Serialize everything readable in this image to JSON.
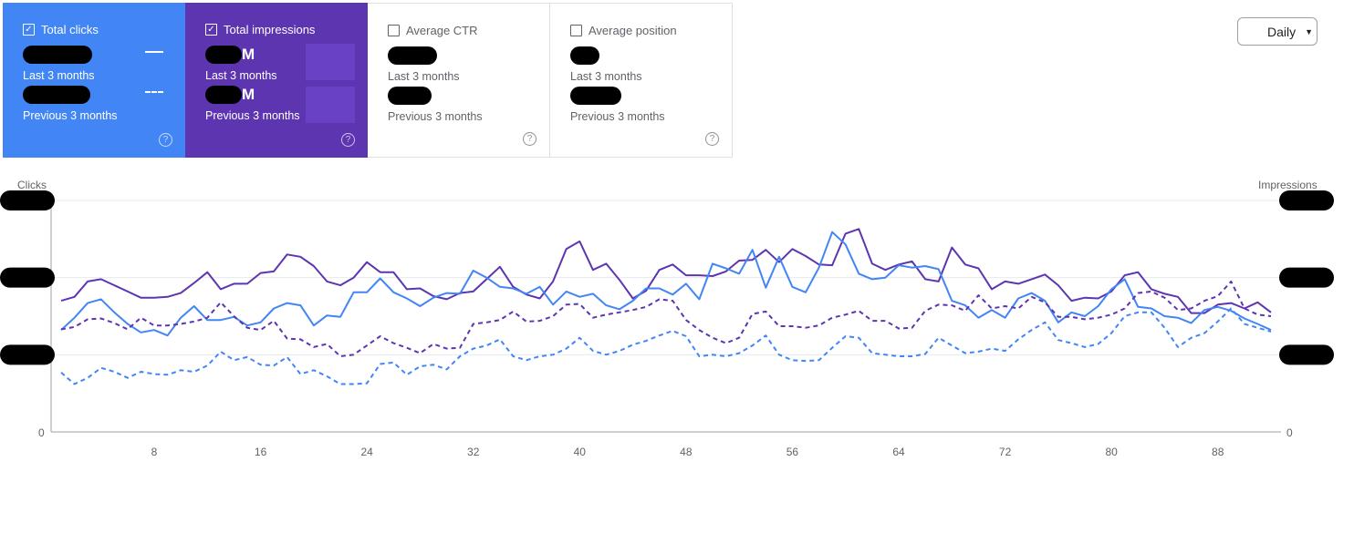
{
  "cards": [
    {
      "label": "Total clicks",
      "checked": true,
      "suffix": "",
      "period1": "Last 3 months",
      "period2": "Previous 3 months"
    },
    {
      "label": "Total impressions",
      "checked": true,
      "suffix": "M",
      "period1": "Last 3 months",
      "period2": "Previous 3 months"
    },
    {
      "label": "Average CTR",
      "checked": false,
      "suffix": "",
      "period1": "Last 3 months",
      "period2": "Previous 3 months"
    },
    {
      "label": "Average position",
      "checked": false,
      "suffix": "",
      "period1": "Last 3 months",
      "period2": "Previous 3 months"
    }
  ],
  "granularity": {
    "label": "Daily"
  },
  "colors": {
    "clicks": "#4285f4",
    "impressions": "#5e35b1",
    "grid": "#e8eaed"
  },
  "chart_data": {
    "type": "line",
    "ylabel_left": "Clicks",
    "ylabel_right": "Impressions",
    "xticks": [
      8,
      16,
      24,
      32,
      40,
      48,
      56,
      64,
      72,
      80,
      88
    ],
    "xlim": [
      1,
      92
    ],
    "ylim": [
      0,
      3
    ],
    "y_tick_labels_left": [
      "0"
    ],
    "y_tick_labels_right": [
      "0"
    ],
    "series": [
      {
        "name": "Total impressions",
        "period": "Last 3 months",
        "style": "solid",
        "color": "#5e35b1",
        "values": [
          1.7,
          1.75,
          1.95,
          1.98,
          1.9,
          1.82,
          1.74,
          1.74,
          1.75,
          1.8,
          1.93,
          2.07,
          1.85,
          1.92,
          1.92,
          2.06,
          2.08,
          2.3,
          2.27,
          2.15,
          1.95,
          1.9,
          2.0,
          2.2,
          2.07,
          2.07,
          1.85,
          1.86,
          1.76,
          1.72,
          1.8,
          1.82,
          1.98,
          2.14,
          1.88,
          1.78,
          1.73,
          1.95,
          2.37,
          2.47,
          2.1,
          2.18,
          1.97,
          1.73,
          1.83,
          2.1,
          2.17,
          2.03,
          2.03,
          2.02,
          2.08,
          2.22,
          2.23,
          2.36,
          2.2,
          2.37,
          2.28,
          2.17,
          2.16,
          2.57,
          2.63,
          2.18,
          2.1,
          2.17,
          2.21,
          1.98,
          1.95,
          2.39,
          2.17,
          2.12,
          1.85,
          1.95,
          1.92,
          1.98,
          2.04,
          1.9,
          1.7,
          1.74,
          1.73,
          1.82,
          2.03,
          2.07,
          1.85,
          1.79,
          1.75,
          1.54,
          1.54,
          1.65,
          1.67,
          1.6,
          1.68,
          1.55
        ]
      },
      {
        "name": "Total clicks",
        "period": "Last 3 months",
        "style": "solid",
        "color": "#4285f4",
        "values": [
          1.32,
          1.48,
          1.67,
          1.72,
          1.55,
          1.4,
          1.29,
          1.32,
          1.25,
          1.48,
          1.63,
          1.45,
          1.45,
          1.49,
          1.38,
          1.42,
          1.6,
          1.67,
          1.64,
          1.38,
          1.51,
          1.49,
          1.81,
          1.81,
          1.99,
          1.81,
          1.73,
          1.63,
          1.74,
          1.8,
          1.79,
          2.09,
          2.0,
          1.88,
          1.86,
          1.79,
          1.88,
          1.65,
          1.82,
          1.75,
          1.79,
          1.64,
          1.59,
          1.7,
          1.86,
          1.86,
          1.78,
          1.92,
          1.72,
          2.18,
          2.12,
          2.05,
          2.36,
          1.87,
          2.27,
          1.88,
          1.81,
          2.13,
          2.59,
          2.43,
          2.05,
          1.98,
          2.0,
          2.16,
          2.13,
          2.15,
          2.11,
          1.7,
          1.64,
          1.48,
          1.58,
          1.48,
          1.73,
          1.8,
          1.7,
          1.42,
          1.55,
          1.5,
          1.63,
          1.85,
          1.98,
          1.62,
          1.6,
          1.5,
          1.48,
          1.41,
          1.58,
          1.62,
          1.57,
          1.47,
          1.4,
          1.32
        ]
      },
      {
        "name": "Total impressions",
        "period": "Previous 3 months",
        "style": "dashed",
        "color": "#5e35b1",
        "values": [
          1.33,
          1.36,
          1.46,
          1.47,
          1.41,
          1.33,
          1.48,
          1.38,
          1.38,
          1.4,
          1.43,
          1.48,
          1.68,
          1.5,
          1.35,
          1.32,
          1.44,
          1.21,
          1.2,
          1.1,
          1.14,
          0.98,
          1.0,
          1.12,
          1.24,
          1.15,
          1.09,
          1.02,
          1.14,
          1.08,
          1.09,
          1.4,
          1.42,
          1.45,
          1.56,
          1.43,
          1.44,
          1.5,
          1.65,
          1.66,
          1.48,
          1.52,
          1.55,
          1.58,
          1.62,
          1.72,
          1.7,
          1.45,
          1.32,
          1.22,
          1.15,
          1.22,
          1.53,
          1.56,
          1.37,
          1.37,
          1.35,
          1.38,
          1.48,
          1.52,
          1.57,
          1.44,
          1.44,
          1.34,
          1.35,
          1.57,
          1.65,
          1.64,
          1.57,
          1.77,
          1.6,
          1.63,
          1.6,
          1.75,
          1.68,
          1.49,
          1.49,
          1.46,
          1.48,
          1.52,
          1.6,
          1.8,
          1.82,
          1.74,
          1.58,
          1.6,
          1.7,
          1.76,
          1.95,
          1.6,
          1.52,
          1.5
        ]
      },
      {
        "name": "Total clicks",
        "period": "Previous 3 months",
        "style": "dashed",
        "color": "#4285f4",
        "values": [
          0.77,
          0.62,
          0.7,
          0.83,
          0.78,
          0.7,
          0.78,
          0.75,
          0.74,
          0.8,
          0.78,
          0.86,
          1.04,
          0.93,
          0.97,
          0.87,
          0.86,
          0.97,
          0.75,
          0.8,
          0.72,
          0.62,
          0.62,
          0.63,
          0.88,
          0.9,
          0.74,
          0.85,
          0.87,
          0.81,
          0.98,
          1.08,
          1.12,
          1.2,
          0.98,
          0.93,
          0.98,
          1.0,
          1.08,
          1.22,
          1.05,
          1.0,
          1.05,
          1.13,
          1.18,
          1.25,
          1.31,
          1.24,
          0.98,
          1.0,
          0.98,
          1.02,
          1.12,
          1.25,
          1.0,
          0.93,
          0.92,
          0.93,
          1.09,
          1.24,
          1.22,
          1.02,
          1.0,
          0.98,
          0.98,
          1.01,
          1.22,
          1.12,
          1.02,
          1.04,
          1.08,
          1.05,
          1.2,
          1.32,
          1.42,
          1.19,
          1.15,
          1.1,
          1.14,
          1.28,
          1.5,
          1.55,
          1.55,
          1.35,
          1.1,
          1.22,
          1.28,
          1.43,
          1.6,
          1.4,
          1.35,
          1.3
        ]
      }
    ]
  }
}
